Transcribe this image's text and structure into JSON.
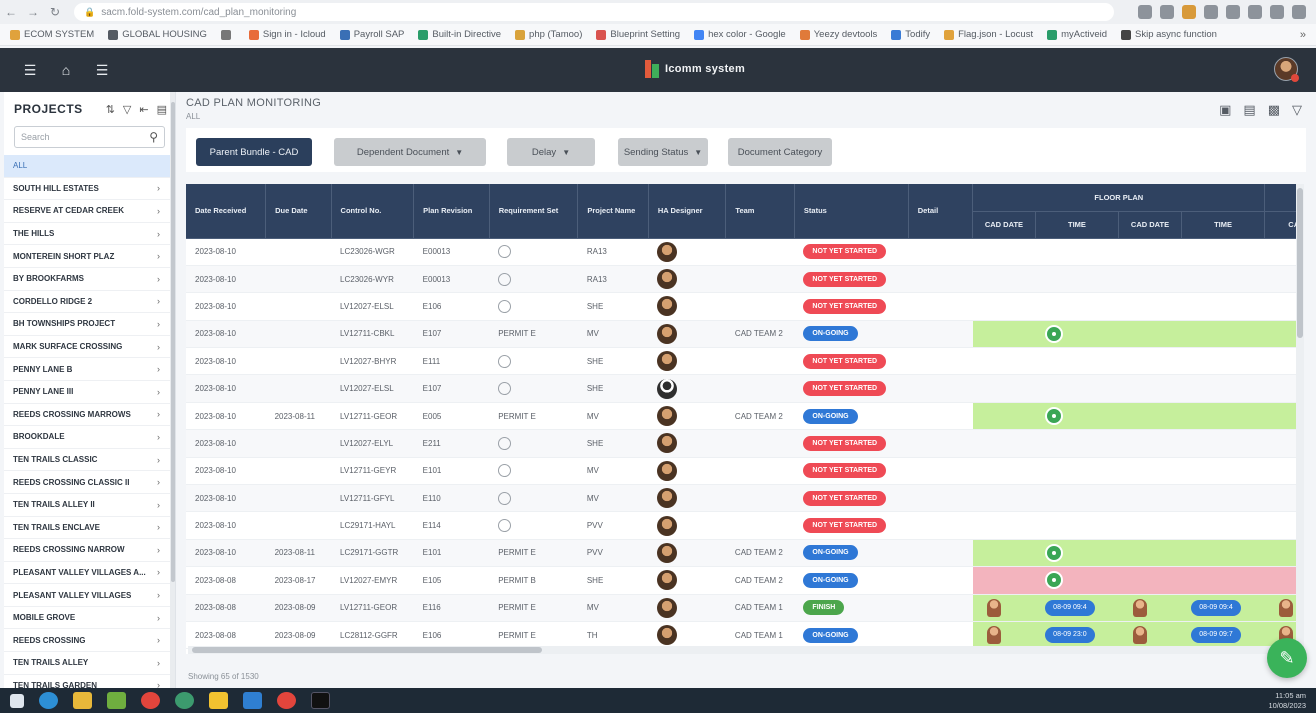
{
  "browser": {
    "url": "sacm.fold-system.com/cad_plan_monitoring",
    "bookmarks": [
      {
        "label": "ECOM SYSTEM",
        "color": "#e0a23c"
      },
      {
        "label": "GLOBAL HOUSING",
        "color": "#555b63"
      },
      {
        "label": "",
        "color": "#777777"
      },
      {
        "label": "Sign in - Icloud",
        "color": "#e86b3a"
      },
      {
        "label": "Payroll SAP",
        "color": "#3a6fb5"
      },
      {
        "label": "Built-in Directive",
        "color": "#2a9d6a"
      },
      {
        "label": "php (Tamoo)",
        "color": "#d9a33c"
      },
      {
        "label": "Blueprint Setting",
        "color": "#d9534f"
      },
      {
        "label": "hex color - Google",
        "color": "#4285f4"
      },
      {
        "label": "Yeezy devtools",
        "color": "#e07a3a"
      },
      {
        "label": "Todify",
        "color": "#3a7bd5"
      },
      {
        "label": "Flag.json - Locust",
        "color": "#e0a23c"
      },
      {
        "label": "myActiveid",
        "color": "#2a9d6a"
      },
      {
        "label": "Skip async function",
        "color": "#444444"
      }
    ]
  },
  "header": {
    "logo_text": "Icomm system"
  },
  "sidebar": {
    "title": "PROJECTS",
    "search_placeholder": "Search",
    "items": [
      {
        "label": "ALL",
        "active": true
      },
      {
        "label": "SOUTH HILL ESTATES"
      },
      {
        "label": "RESERVE AT CEDAR CREEK"
      },
      {
        "label": "THE HILLS"
      },
      {
        "label": "MONTEREIN SHORT PLAZ"
      },
      {
        "label": "BY BROOKFARMS"
      },
      {
        "label": "CORDELLO RIDGE 2"
      },
      {
        "label": "BH TOWNSHIPS PROJECT"
      },
      {
        "label": "MARK SURFACE CROSSING"
      },
      {
        "label": "PENNY LANE B"
      },
      {
        "label": "PENNY LANE III"
      },
      {
        "label": "REEDS CROSSING MARROWS"
      },
      {
        "label": "BROOKDALE"
      },
      {
        "label": "TEN TRAILS CLASSIC"
      },
      {
        "label": "REEDS CROSSING CLASSIC II"
      },
      {
        "label": "TEN TRAILS ALLEY II"
      },
      {
        "label": "TEN TRAILS ENCLAVE"
      },
      {
        "label": "REEDS CROSSING NARROW"
      },
      {
        "label": "PLEASANT VALLEY VILLAGES A..."
      },
      {
        "label": "PLEASANT VALLEY VILLAGES"
      },
      {
        "label": "MOBILE GROVE"
      },
      {
        "label": "REEDS CROSSING"
      },
      {
        "label": "TEN TRAILS ALLEY"
      },
      {
        "label": "TEN TRAILS GARDEN"
      }
    ]
  },
  "page": {
    "title": "CAD PLAN MONITORING",
    "subtitle": "ALL",
    "filters": [
      {
        "label": "Parent Bundle - CAD",
        "style": "primary",
        "caret": false
      },
      {
        "label": "Dependent Document",
        "style": "grey",
        "caret": true
      },
      {
        "label": "Delay",
        "style": "grey",
        "caret": true
      },
      {
        "label": "Sending Status",
        "style": "grey",
        "caret": true
      },
      {
        "label": "Document Category",
        "style": "grey",
        "caret": false
      }
    ],
    "footer": "Showing 65 of 1530"
  },
  "table": {
    "headers": [
      "Date Received",
      "Due Date",
      "Control No.",
      "Plan Revision",
      "Requirement Set",
      "Project Name",
      "HA Designer",
      "Team",
      "Status",
      "Detail"
    ],
    "group_header": "FLOOR PLAN",
    "sub_headers": [
      "CAD DATE",
      "TIME",
      "CAD DATE",
      "TIME",
      "CAD D"
    ],
    "rows": [
      {
        "date": "2023-08-10",
        "due": "",
        "control": "LC23026-WGR",
        "rev": "E00013",
        "req": "radio",
        "proj": "RA13",
        "avatar": "a",
        "team": "",
        "status": "NOT YET STARTED",
        "status_color": "red",
        "fp": "none"
      },
      {
        "date": "2023-08-10",
        "due": "",
        "control": "LC23026-WYR",
        "rev": "E00013",
        "req": "radio",
        "proj": "RA13",
        "avatar": "a",
        "team": "",
        "status": "NOT YET STARTED",
        "status_color": "red",
        "fp": "none"
      },
      {
        "date": "2023-08-10",
        "due": "",
        "control": "LV12027-ELSL",
        "rev": "E106",
        "req": "radio",
        "proj": "SHE",
        "avatar": "a",
        "team": "",
        "status": "NOT YET STARTED",
        "status_color": "red",
        "fp": "none"
      },
      {
        "date": "2023-08-10",
        "due": "",
        "control": "LV12711-CBKL",
        "rev": "E107",
        "req": "PERMIT E",
        "proj": "MV",
        "avatar": "a",
        "team": "CAD TEAM 2",
        "status": "ON-GOING",
        "status_color": "blue",
        "fp": "green-dot"
      },
      {
        "date": "2023-08-10",
        "due": "",
        "control": "LV12027-BHYR",
        "rev": "E111",
        "req": "radio",
        "proj": "SHE",
        "avatar": "a",
        "team": "",
        "status": "NOT YET STARTED",
        "status_color": "red",
        "fp": "none"
      },
      {
        "date": "2023-08-10",
        "due": "",
        "control": "LV12027-ELSL",
        "rev": "E107",
        "req": "radio",
        "proj": "SHE",
        "avatar": "d",
        "team": "",
        "status": "NOT YET STARTED",
        "status_color": "red",
        "fp": "none"
      },
      {
        "date": "2023-08-10",
        "due": "2023-08-11",
        "control": "LV12711-GEOR",
        "rev": "E005",
        "req": "PERMIT E",
        "proj": "MV",
        "avatar": "a",
        "team": "CAD TEAM 2",
        "status": "ON-GOING",
        "status_color": "blue",
        "fp": "green-dot"
      },
      {
        "date": "2023-08-10",
        "due": "",
        "control": "LV12027-ELYL",
        "rev": "E211",
        "req": "radio",
        "proj": "SHE",
        "avatar": "a",
        "team": "",
        "status": "NOT YET STARTED",
        "status_color": "red",
        "fp": "none"
      },
      {
        "date": "2023-08-10",
        "due": "",
        "control": "LV12711-GEYR",
        "rev": "E101",
        "req": "radio",
        "proj": "MV",
        "avatar": "a",
        "team": "",
        "status": "NOT YET STARTED",
        "status_color": "red",
        "fp": "none"
      },
      {
        "date": "2023-08-10",
        "due": "",
        "control": "LV12711-GFYL",
        "rev": "E110",
        "req": "radio",
        "proj": "MV",
        "avatar": "a",
        "team": "",
        "status": "NOT YET STARTED",
        "status_color": "red",
        "fp": "none"
      },
      {
        "date": "2023-08-10",
        "due": "",
        "control": "LC29171-HAYL",
        "rev": "E114",
        "req": "radio",
        "proj": "PVV",
        "avatar": "a",
        "team": "",
        "status": "NOT YET STARTED",
        "status_color": "red",
        "fp": "none"
      },
      {
        "date": "2023-08-10",
        "due": "2023-08-11",
        "control": "LC29171-GGTR",
        "rev": "E101",
        "req": "PERMIT E",
        "proj": "PVV",
        "avatar": "a",
        "team": "CAD TEAM 2",
        "status": "ON-GOING",
        "status_color": "blue",
        "fp": "green-dot"
      },
      {
        "date": "2023-08-08",
        "due": "2023-08-17",
        "control": "LV12027-EMYR",
        "rev": "E105",
        "req": "PERMIT B",
        "proj": "SHE",
        "avatar": "a",
        "team": "CAD TEAM 2",
        "status": "ON-GOING",
        "status_color": "blue",
        "fp": "red-dot"
      },
      {
        "date": "2023-08-08",
        "due": "2023-08-09",
        "control": "LV12711-GEOR",
        "rev": "E116",
        "req": "PERMIT E",
        "proj": "MV",
        "avatar": "a",
        "team": "CAD TEAM 1",
        "status": "FINISH",
        "status_color": "green",
        "fp": "green-cad",
        "cad1": "08-09 09:4",
        "cad2": "08-09 09:4"
      },
      {
        "date": "2023-08-08",
        "due": "2023-08-09",
        "control": "LC28112-GGFR",
        "rev": "E106",
        "req": "PERMIT E",
        "proj": "TH",
        "avatar": "a",
        "team": "CAD TEAM 1",
        "status": "ON-GOING",
        "status_color": "blue",
        "fp": "green-cad",
        "cad1": "08-09 23:0",
        "cad2": "08-09 09:7"
      }
    ]
  },
  "taskbar": {
    "time": "11:05 am",
    "date": "10/08/2023"
  }
}
